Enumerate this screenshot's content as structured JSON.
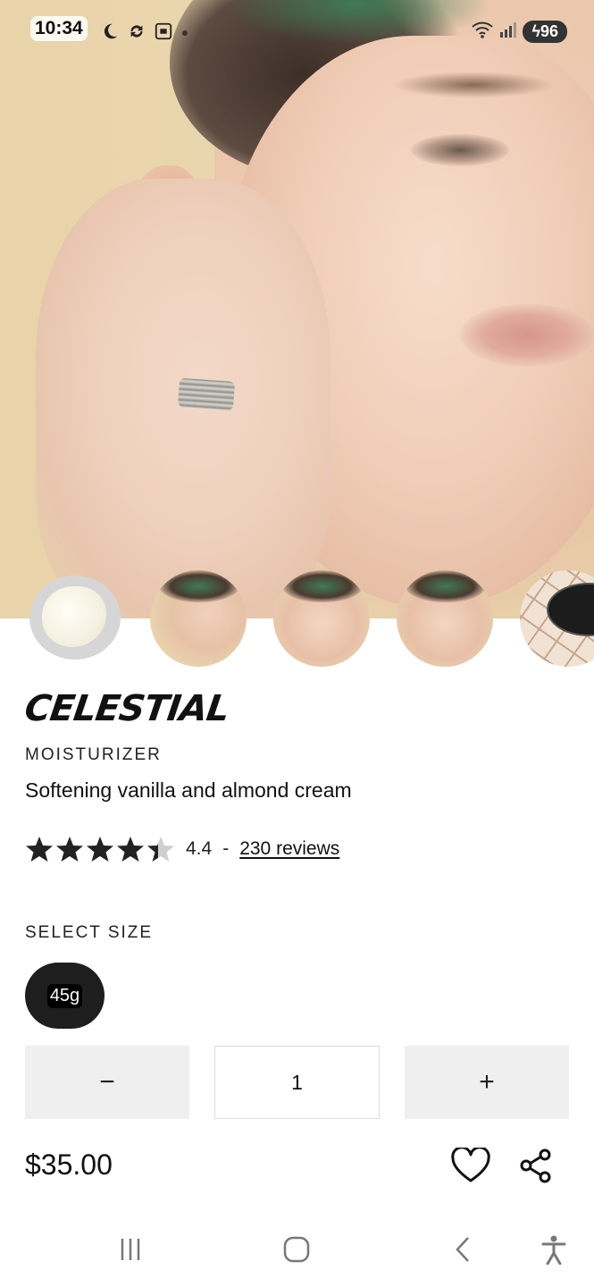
{
  "status_bar": {
    "time": "10:34",
    "battery": "96"
  },
  "product": {
    "name": "CELESTIAL",
    "category": "MOISTURIZER",
    "description": "Softening vanilla and almond cream",
    "rating": "4.4",
    "rating_value": 4.4,
    "separator": "-",
    "reviews_text": "230 reviews"
  },
  "size": {
    "label": "SELECT SIZE",
    "options": [
      "45g"
    ],
    "selected": "45g"
  },
  "quantity": {
    "minus": "−",
    "value": "1",
    "plus": "+"
  },
  "price": "$35.00",
  "icons": {
    "favorite": "heart-icon",
    "share": "share-icon",
    "nav": [
      "recent-apps-icon",
      "home-icon",
      "back-icon",
      "accessibility-icon"
    ]
  },
  "colors": {
    "size_pill": "#1e1e1e",
    "qty_button_bg": "#efefef"
  }
}
